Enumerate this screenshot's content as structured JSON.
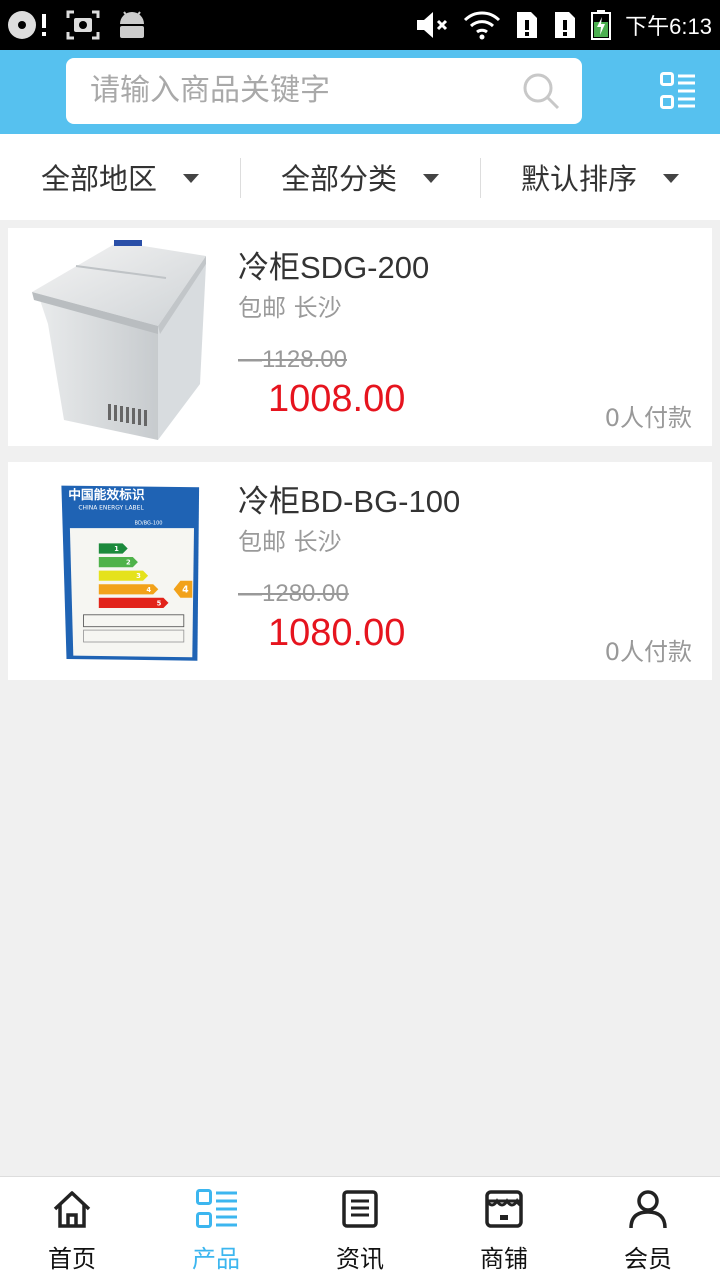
{
  "status_bar": {
    "time": "下午6:13",
    "icons": [
      "disc-alert-icon",
      "screenshot-icon",
      "android-icon",
      "mute-icon",
      "wifi-icon",
      "sim1-alert-icon",
      "sim2-alert-icon",
      "battery-charging-icon"
    ]
  },
  "header": {
    "search_placeholder": "请输入商品关键字",
    "search_icon": "search-icon",
    "menu_icon": "list-menu-icon",
    "background": "#56c1ef"
  },
  "filters": [
    {
      "label": "全部地区"
    },
    {
      "label": "全部分类"
    },
    {
      "label": "默认排序"
    }
  ],
  "products": [
    {
      "title": "冷柜SDG-200",
      "meta": "包邮 长沙",
      "original_price": "1128.00",
      "price": "1008.00",
      "paid": "0人付款",
      "image": "chest-freezer-photo"
    },
    {
      "title": "冷柜BD-BG-100",
      "meta": "包邮 长沙",
      "original_price": "1280.00",
      "price": "1080.00",
      "paid": "0人付款",
      "image": "energy-label-photo",
      "image_text": {
        "title_cn": "中国能效标识",
        "title_en": "CHINA ENERGY LABEL",
        "model": "BD/BG-100",
        "grades": [
          "1",
          "2",
          "3",
          "4",
          "5"
        ],
        "rating": "4"
      }
    }
  ],
  "bottom_nav": [
    {
      "label": "首页",
      "icon": "home-icon",
      "active": false
    },
    {
      "label": "产品",
      "icon": "product-list-icon",
      "active": true
    },
    {
      "label": "资讯",
      "icon": "news-icon",
      "active": false
    },
    {
      "label": "商铺",
      "icon": "store-icon",
      "active": false
    },
    {
      "label": "会员",
      "icon": "member-icon",
      "active": false
    }
  ],
  "colors": {
    "accent": "#56c1ef",
    "active_nav": "#3cb6ef",
    "price": "#e6141e"
  }
}
